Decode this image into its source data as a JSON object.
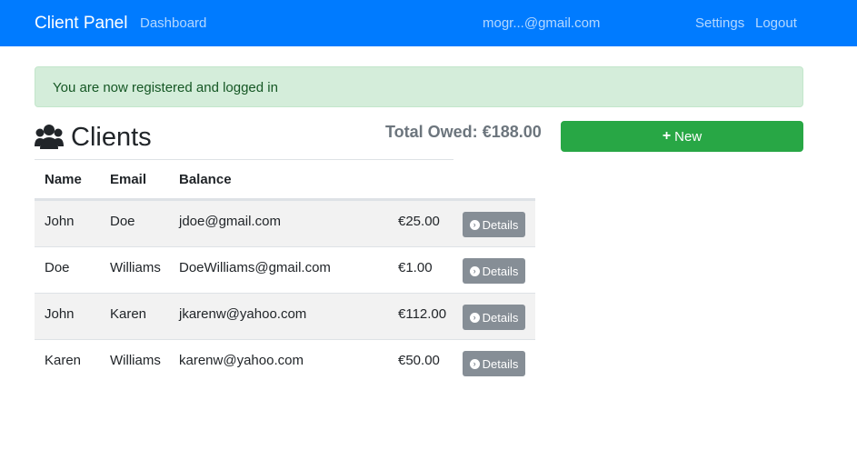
{
  "navbar": {
    "brand": "Client Panel",
    "dashboard": "Dashboard",
    "user_email": "mogr...@gmail.com",
    "settings": "Settings",
    "logout": "Logout",
    "color": "#007bff"
  },
  "alert": {
    "message": "You are now registered and logged in"
  },
  "clients": {
    "title": "Clients",
    "icon": "users-icon",
    "total_label": "Total Owed:",
    "total_value": "€188.00",
    "new_button": "New",
    "details_label": "Details",
    "columns": [
      "Name",
      "Email",
      "Balance"
    ],
    "rows": [
      {
        "first": "John",
        "last": "Doe",
        "email": "jdoe@gmail.com",
        "balance": "€25.00"
      },
      {
        "first": "Doe",
        "last": "Williams",
        "email": "DoeWilliams@gmail.com",
        "balance": "€1.00"
      },
      {
        "first": "John",
        "last": "Karen",
        "email": "jkarenw@yahoo.com",
        "balance": "€112.00"
      },
      {
        "first": "Karen",
        "last": "Williams",
        "email": "karenw@yahoo.com",
        "balance": "€50.00"
      }
    ]
  },
  "colors": {
    "primary": "#007bff",
    "success": "#28a745",
    "secondary": "#868e96",
    "alert_bg": "#d4edda",
    "alert_text": "#155724"
  }
}
